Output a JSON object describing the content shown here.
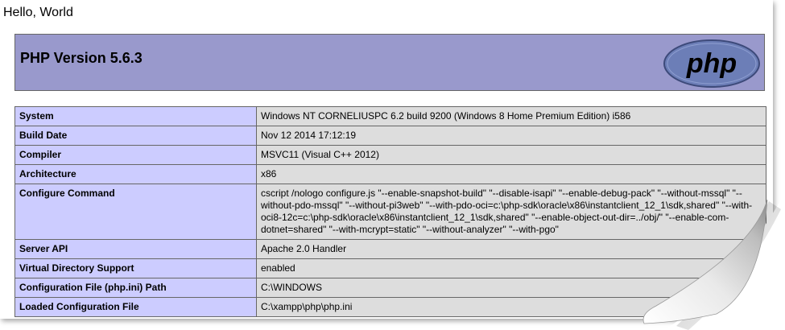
{
  "greeting": "Hello, World",
  "header": {
    "title": "PHP Version 5.6.3",
    "logo_text": "php",
    "background": "#9999cc"
  },
  "table": {
    "rows": [
      {
        "key": "System",
        "value": "Windows NT CORNELIUSPC 6.2 build 9200 (Windows 8 Home Premium Edition) i586"
      },
      {
        "key": "Build Date",
        "value": "Nov 12 2014 17:12:19"
      },
      {
        "key": "Compiler",
        "value": "MSVC11 (Visual C++ 2012)"
      },
      {
        "key": "Architecture",
        "value": "x86"
      },
      {
        "key": "Configure Command",
        "value": "cscript /nologo configure.js \"--enable-snapshot-build\" \"--disable-isapi\" \"--enable-debug-pack\" \"--without-mssql\" \"--without-pdo-mssql\" \"--without-pi3web\" \"--with-pdo-oci=c:\\php-sdk\\oracle\\x86\\instantclient_12_1\\sdk,shared\" \"--with-oci8-12c=c:\\php-sdk\\oracle\\x86\\instantclient_12_1\\sdk,shared\" \"--enable-object-out-dir=../obj/\" \"--enable-com-dotnet=shared\" \"--with-mcrypt=static\" \"--without-analyzer\" \"--with-pgo\""
      },
      {
        "key": "Server API",
        "value": "Apache 2.0 Handler"
      },
      {
        "key": "Virtual Directory Support",
        "value": "enabled"
      },
      {
        "key": "Configuration File (php.ini) Path",
        "value": "C:\\WINDOWS"
      },
      {
        "key": "Loaded Configuration File",
        "value": "C:\\xampp\\php\\php.ini"
      }
    ],
    "key_color": "#ccccff",
    "value_color": "#dddddd"
  }
}
